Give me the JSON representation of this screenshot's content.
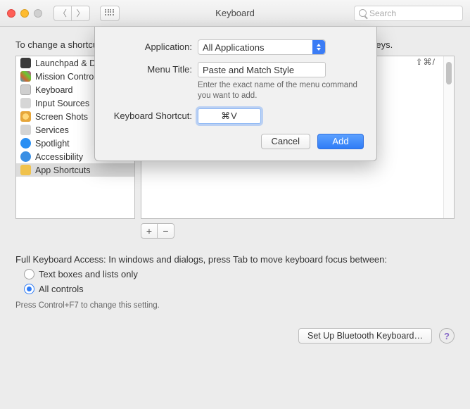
{
  "titlebar": {
    "title": "Keyboard",
    "search_placeholder": "Search"
  },
  "main": {
    "instruction": "To change a shortcut, select it, double-click the key combination, and then type the new keys.",
    "shortcut_display": "⇧⌘/",
    "sidebar": [
      {
        "label": "Launchpad & Dock"
      },
      {
        "label": "Mission Control"
      },
      {
        "label": "Keyboard"
      },
      {
        "label": "Input Sources"
      },
      {
        "label": "Screen Shots"
      },
      {
        "label": "Services"
      },
      {
        "label": "Spotlight"
      },
      {
        "label": "Accessibility"
      },
      {
        "label": "App Shortcuts"
      }
    ],
    "fka_text": "Full Keyboard Access: In windows and dialogs, press Tab to move keyboard focus between:",
    "radio1": "Text boxes and lists only",
    "radio2": "All controls",
    "hint": "Press Control+F7 to change this setting.",
    "bt_button": "Set Up Bluetooth Keyboard…",
    "help": "?"
  },
  "sheet": {
    "app_label": "Application:",
    "app_value": "All Applications",
    "menu_label": "Menu Title:",
    "menu_value": "Paste and Match Style",
    "menu_help": "Enter the exact name of the menu command you want to add.",
    "shortcut_label": "Keyboard Shortcut:",
    "shortcut_value": "⌘V",
    "cancel": "Cancel",
    "add": "Add"
  }
}
